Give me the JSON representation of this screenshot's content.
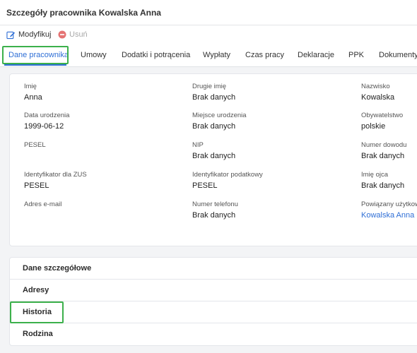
{
  "header": {
    "title": "Szczegóły pracownika Kowalska Anna"
  },
  "toolbar": {
    "edit_label": "Modyfikuj",
    "delete_label": "Usuń",
    "edit_icon": "edit-icon",
    "delete_icon": "minus-circle-icon",
    "delete_color": "#e57373"
  },
  "tabs": [
    {
      "label": "Dane pracownika",
      "active": true
    },
    {
      "label": "Umowy"
    },
    {
      "label": "Dodatki i potrącenia"
    },
    {
      "label": "Wypłaty"
    },
    {
      "label": "Czas pracy"
    },
    {
      "label": "Deklaracje"
    },
    {
      "label": "PPK"
    },
    {
      "label": "Dokumenty"
    }
  ],
  "fields": {
    "imie": {
      "label": "Imię",
      "value": "Anna"
    },
    "drugie_imie": {
      "label": "Drugie imię",
      "value": "Brak danych"
    },
    "nazwisko": {
      "label": "Nazwisko",
      "value": "Kowalska"
    },
    "data_urodzenia": {
      "label": "Data urodzenia",
      "value": "1999-06-12"
    },
    "miejsce_urodzenia": {
      "label": "Miejsce urodzenia",
      "value": "Brak danych"
    },
    "obywatelstwo": {
      "label": "Obywatelstwo",
      "value": "polskie"
    },
    "pesel": {
      "label": "PESEL",
      "value": ""
    },
    "nip": {
      "label": "NIP",
      "value": "Brak danych"
    },
    "numer_dowodu": {
      "label": "Numer dowodu",
      "value": "Brak danych"
    },
    "identyfikator_zus": {
      "label": "Identyfikator dla ZUS",
      "value": "PESEL"
    },
    "identyfikator_podatkowy": {
      "label": "Identyfikator podatkowy",
      "value": "PESEL"
    },
    "imie_ojca": {
      "label": "Imię ojca",
      "value": "Brak danych"
    },
    "adres_email": {
      "label": "Adres e-mail",
      "value": ""
    },
    "numer_telefonu": {
      "label": "Numer telefonu",
      "value": "Brak danych"
    },
    "powiazany_uzytkownik": {
      "label": "Powiązany użytkow",
      "value": "Kowalska Anna"
    }
  },
  "sections": [
    {
      "label": "Dane szczegółowe"
    },
    {
      "label": "Adresy"
    },
    {
      "label": "Historia"
    },
    {
      "label": "Rodzina"
    }
  ],
  "colors": {
    "accent": "#2f6fd6",
    "highlight": "#3cb04b",
    "link": "#2f6fd6"
  }
}
